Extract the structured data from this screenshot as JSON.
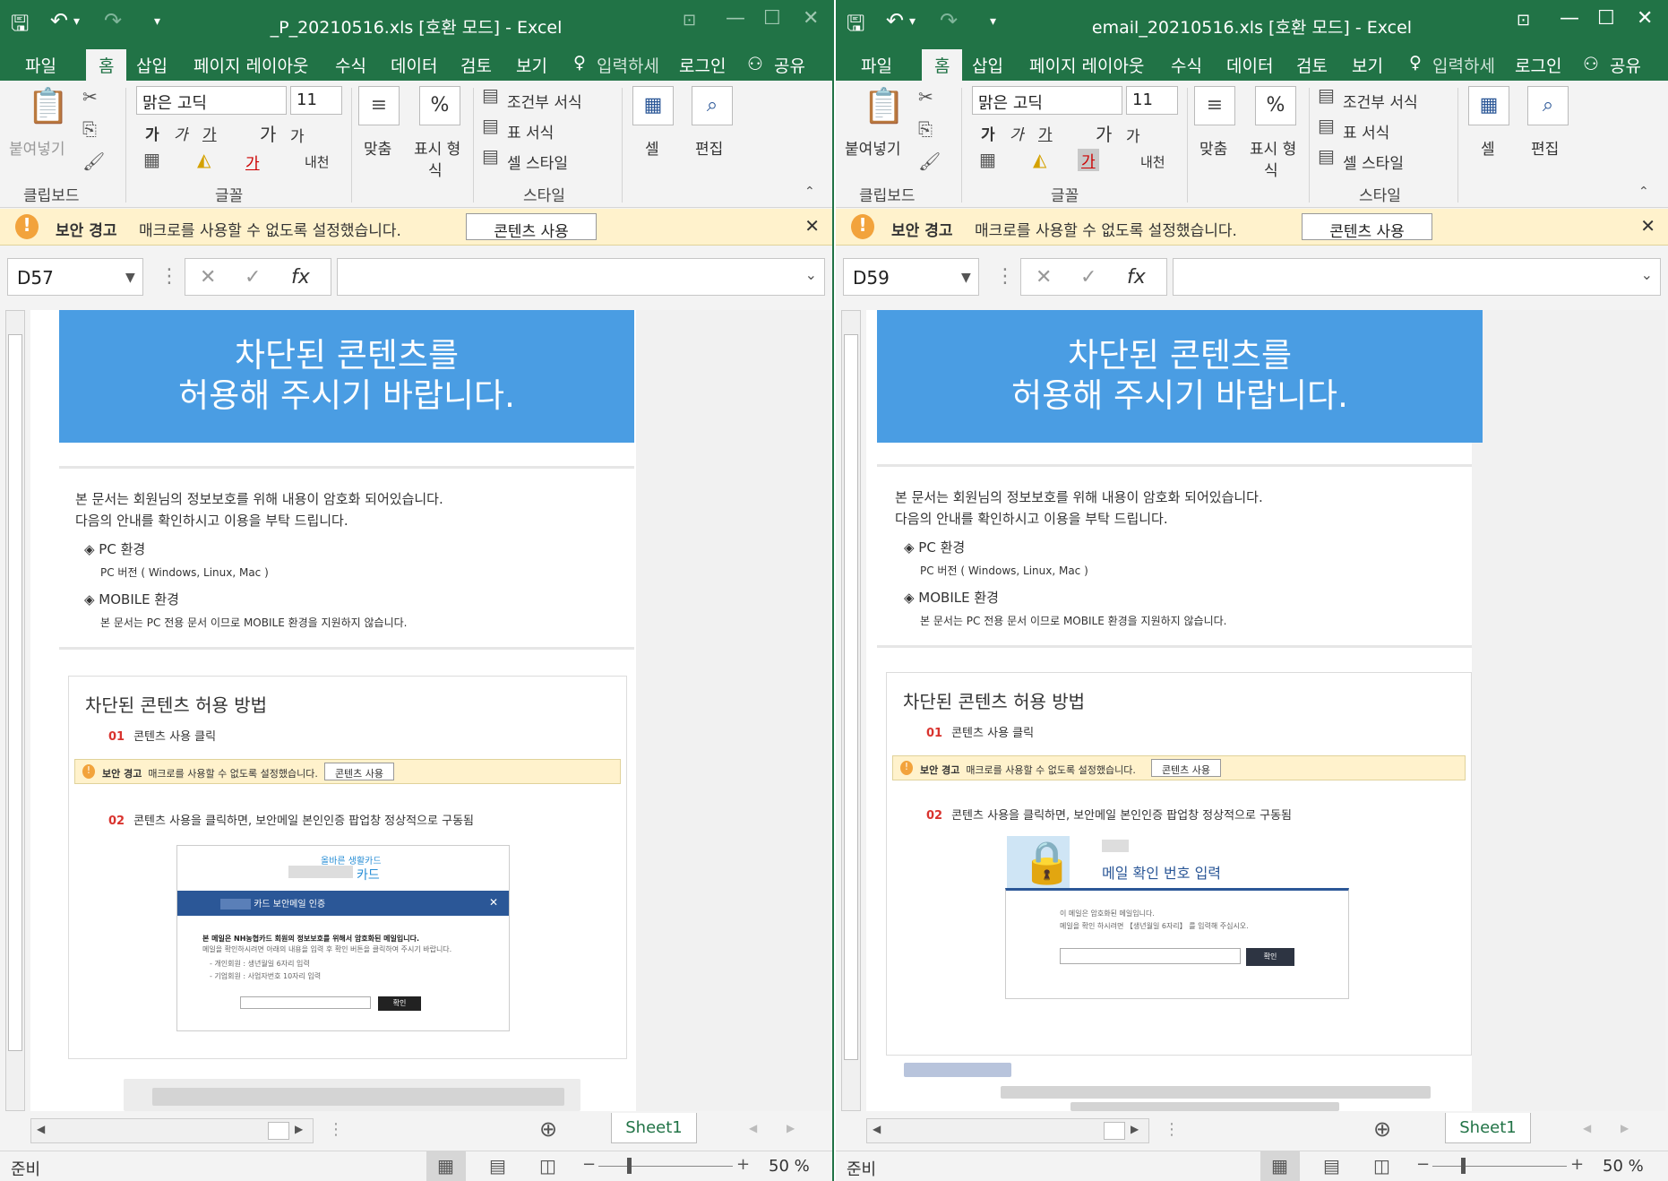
{
  "windows": [
    {
      "title": "_P_20210516.xls  [호환 모드] - Excel",
      "ribbon_tabs": [
        "파일",
        "홈",
        "삽입",
        "페이지 레이아웃",
        "수식",
        "데이터",
        "검토",
        "보기"
      ],
      "tell_me": "입력하세",
      "login": "로그인",
      "share": "공유",
      "font_name": "맑은 고딕",
      "font_size": "11",
      "paste_label": "붙여넣기",
      "groups": {
        "clipboard": "클립보드",
        "font": "글꼴",
        "style": "스타일"
      },
      "align_label": "맞춤",
      "number_label1": "표시 형",
      "number_label2": "식",
      "cond_format": "조건부 서식",
      "table_format": "표 서식",
      "cell_style": "셀 스타일",
      "cells_label": "셀",
      "edit_label": "편집",
      "wrap": "내천",
      "security": {
        "bold": "보안 경고",
        "message": "매크로를 사용할 수 없도록 설정했습니다.",
        "button": "콘텐츠 사용"
      },
      "name_box": "D57",
      "doc": {
        "banner_line1": "차단된 콘텐츠를",
        "banner_line2": "허용해 주시기 바랍니다.",
        "intro1": "본 문서는 회원님의 정보보호를 위해 내용이 암호화 되어있습니다.",
        "intro2": "다음의 안내를 확인하시고 이용을 부탁 드립니다.",
        "pc_head": "◈ PC 환경",
        "pc_desc": "PC 버전 ( Windows, Linux, Mac )",
        "mobile_head": "◈ MOBILE 환경",
        "mobile_desc": "본 문서는 PC 전용 문서 이므로 MOBILE 환경을 지원하지 않습니다.",
        "guide_title": "차단된 콘텐츠 허용 방법",
        "step1_num": "01",
        "step1": "콘텐츠 사용 클릭",
        "mini_bold": "보안 경고",
        "mini_msg": "매크로를 사용할 수 없도록 설정했습니다.",
        "mini_btn": "콘텐츠 사용",
        "step2_num": "02",
        "step2": "콘텐츠 사용을 클릭하면, 보안메일 본인인증 팝업창 정상적으로 구동됨",
        "popup": {
          "brand_top": "올바른 생활카드",
          "brand": "카드",
          "header": "카드 보안메일 인증",
          "bold": "본 메일은 NH농협카드 회원의 정보보호를 위해서 암호화된 메일입니다.",
          "line": "메일을 확인하시려면 아래의 내용을 입력 후 확인 버튼을 클릭하여 주시기 바랍니다.",
          "b1": "- 개인회원 : 생년월일 6자리 입력",
          "b2": "- 기업회원 : 사업자번호 10자리 입력",
          "ok": "확인"
        }
      },
      "sheet_tab": "Sheet1",
      "status": "준비",
      "zoom": "50 %"
    },
    {
      "title": "email_20210516.xls  [호환 모드] - Excel",
      "ribbon_tabs": [
        "파일",
        "홈",
        "삽입",
        "페이지 레이아웃",
        "수식",
        "데이터",
        "검토",
        "보기"
      ],
      "tell_me": "입력하세",
      "login": "로그인",
      "share": "공유",
      "font_name": "맑은 고딕",
      "font_size": "11",
      "paste_label": "붙여넣기",
      "groups": {
        "clipboard": "클립보드",
        "font": "글꼴",
        "style": "스타일"
      },
      "align_label": "맞춤",
      "number_label1": "표시 형",
      "number_label2": "식",
      "cond_format": "조건부 서식",
      "table_format": "표 서식",
      "cell_style": "셀 스타일",
      "cells_label": "셀",
      "edit_label": "편집",
      "wrap": "내천",
      "security": {
        "bold": "보안 경고",
        "message": "매크로를 사용할 수 없도록 설정했습니다.",
        "button": "콘텐츠 사용"
      },
      "name_box": "D59",
      "doc": {
        "banner_line1": "차단된 콘텐츠를",
        "banner_line2": "허용해 주시기 바랍니다.",
        "intro1": "본 문서는 회원님의 정보보호를 위해 내용이 암호화 되어있습니다.",
        "intro2": "다음의 안내를 확인하시고 이용을 부탁 드립니다.",
        "pc_head": "◈ PC 환경",
        "pc_desc": "PC 버전 ( Windows, Linux, Mac )",
        "mobile_head": "◈ MOBILE 환경",
        "mobile_desc": "본 문서는 PC 전용 문서 이므로 MOBILE 환경을 지원하지 않습니다.",
        "guide_title": "차단된 콘텐츠 허용 방법",
        "step1_num": "01",
        "step1": "콘텐츠 사용 클릭",
        "mini_bold": "보안 경고",
        "mini_msg": "매크로를 사용할 수 없도록 설정했습니다.",
        "mini_btn": "콘텐츠 사용",
        "step2_num": "02",
        "step2": "콘텐츠 사용을 클릭하면, 보안메일 본인인증 팝업창 정상적으로 구동됨",
        "popup": {
          "header": "메일 확인 번호 입력",
          "line1": "이 메일은 암호화된 메일입니다.",
          "line2": "메일을 확인 하시려면 【생년월일 6자리】 를 입력해 주십시오.",
          "ok": "확인"
        }
      },
      "sheet_tab": "Sheet1",
      "status": "준비",
      "zoom": "50 %"
    }
  ],
  "colors": {
    "excel_green": "#217346",
    "banner_blue": "#4a9de3",
    "security_yellow": "#fff2cc",
    "step_red": "#d9332e"
  }
}
